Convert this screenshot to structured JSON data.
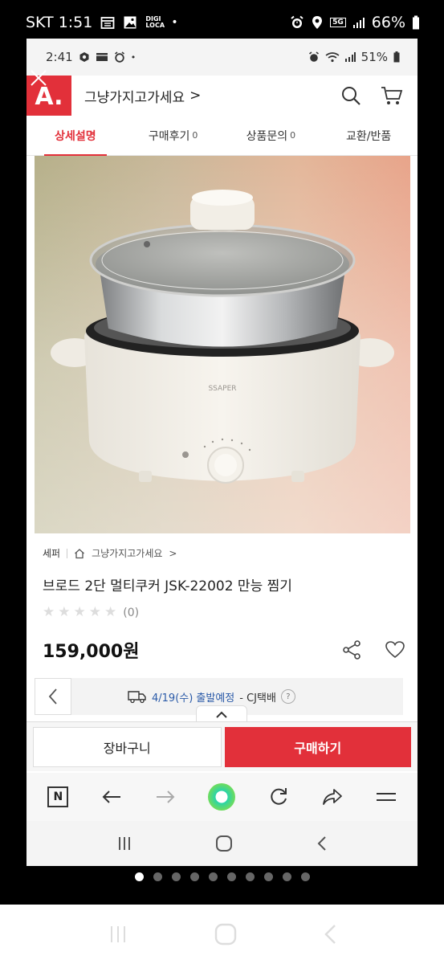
{
  "outer_status": {
    "carrier_time": "SKT 1:51",
    "digi_label": "DIGI LOCA",
    "battery": "66%",
    "network": "5G"
  },
  "inner_status": {
    "time": "2:41",
    "battery": "51%"
  },
  "header": {
    "logo": "A.",
    "store_name": "그냥가지고가세요",
    "chevron": ">"
  },
  "tabs": [
    {
      "label": "상세설명",
      "count": ""
    },
    {
      "label": "구매후기",
      "count": "0"
    },
    {
      "label": "상품문의",
      "count": "0"
    },
    {
      "label": "교환/반품",
      "count": ""
    }
  ],
  "product": {
    "brand": "세퍼",
    "store_link": "그냥가지고가세요",
    "chevron": ">",
    "name": "브로드 2단 멀티쿠커 JSK-22002 만능 찜기",
    "image_brand_text": "SSAPER",
    "rating_value": 0,
    "rating_max": 5,
    "review_count": "(0)",
    "price": "159,000원"
  },
  "shipping": {
    "date": "4/19(수) 출발예정",
    "carrier": "- CJ택배",
    "help": "?"
  },
  "actions": {
    "cart": "장바구니",
    "buy": "구매하기"
  },
  "pager": {
    "count": 10,
    "active": 0
  },
  "colors": {
    "accent": "#e2303a",
    "ship_date": "#2a5aa8"
  }
}
